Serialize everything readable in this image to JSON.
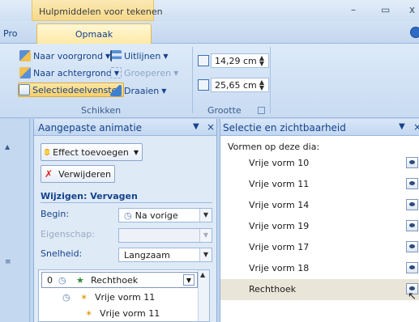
{
  "titlebar": {
    "context_tab_title": "Hulpmiddelen voor tekenen",
    "window_controls": [
      "–",
      "▭",
      "x"
    ]
  },
  "tabs": {
    "left_partial": "Pro",
    "active": "Opmaak"
  },
  "ribbon": {
    "schikken": {
      "label": "Schikken",
      "items": [
        {
          "label": "Naar voorgrond",
          "has_dropdown": true,
          "enabled": true
        },
        {
          "label": "Uitlijnen",
          "has_dropdown": true,
          "enabled": true
        },
        {
          "label": "Naar achtergrond",
          "has_dropdown": true,
          "enabled": true
        },
        {
          "label": "Groeperen",
          "has_dropdown": true,
          "enabled": false
        },
        {
          "label": "Selectiedeelvenster",
          "has_dropdown": false,
          "enabled": true,
          "selected": true
        },
        {
          "label": "Draaien",
          "has_dropdown": true,
          "enabled": true
        }
      ]
    },
    "grootte": {
      "label": "Grootte",
      "height": "14,29 cm",
      "width": "25,65 cm"
    }
  },
  "animation_pane": {
    "title": "Aangepaste animatie",
    "add_effect_button": "Effect toevoegen",
    "remove_button": "Verwijderen",
    "modify_heading": "Wijzigen: Vervagen",
    "start_label": "Begin:",
    "start_value": "Na vorige",
    "property_label": "Eigenschap:",
    "property_value": "",
    "speed_label": "Snelheid:",
    "speed_value": "Langzaam",
    "list": [
      {
        "index": "0",
        "label": "Rechthoek",
        "selected": true
      },
      {
        "index": "",
        "label": "Vrije vorm 11",
        "selected": false
      },
      {
        "index": "",
        "label": "Vrije vorm 11",
        "selected": false
      }
    ]
  },
  "selection_pane": {
    "title": "Selectie en zichtbaarheid",
    "heading": "Vormen op deze dia:",
    "shapes": [
      {
        "label": "Vrije vorm 10",
        "selected": false
      },
      {
        "label": "Vrije vorm 11",
        "selected": false
      },
      {
        "label": "Vrije vorm 14",
        "selected": false
      },
      {
        "label": "Vrije vorm 19",
        "selected": false
      },
      {
        "label": "Vrije vorm 17",
        "selected": false
      },
      {
        "label": "Vrije vorm 18",
        "selected": false
      },
      {
        "label": "Rechthoek",
        "selected": true
      }
    ]
  },
  "colors": {
    "accent_text": "#15428b",
    "ribbon_bg": "#c8dbf2",
    "selected_highlight": "#f9cf66",
    "context_tab": "#f5d98a"
  },
  "icons": {
    "bring_forward": "bring-forward-icon",
    "align": "align-icon",
    "send_backward": "send-backward-icon",
    "group": "group-icon",
    "selection_pane": "selection-pane-icon",
    "rotate": "rotate-icon",
    "height": "shape-height-icon",
    "width": "shape-width-icon",
    "visibility": "eye-icon"
  }
}
